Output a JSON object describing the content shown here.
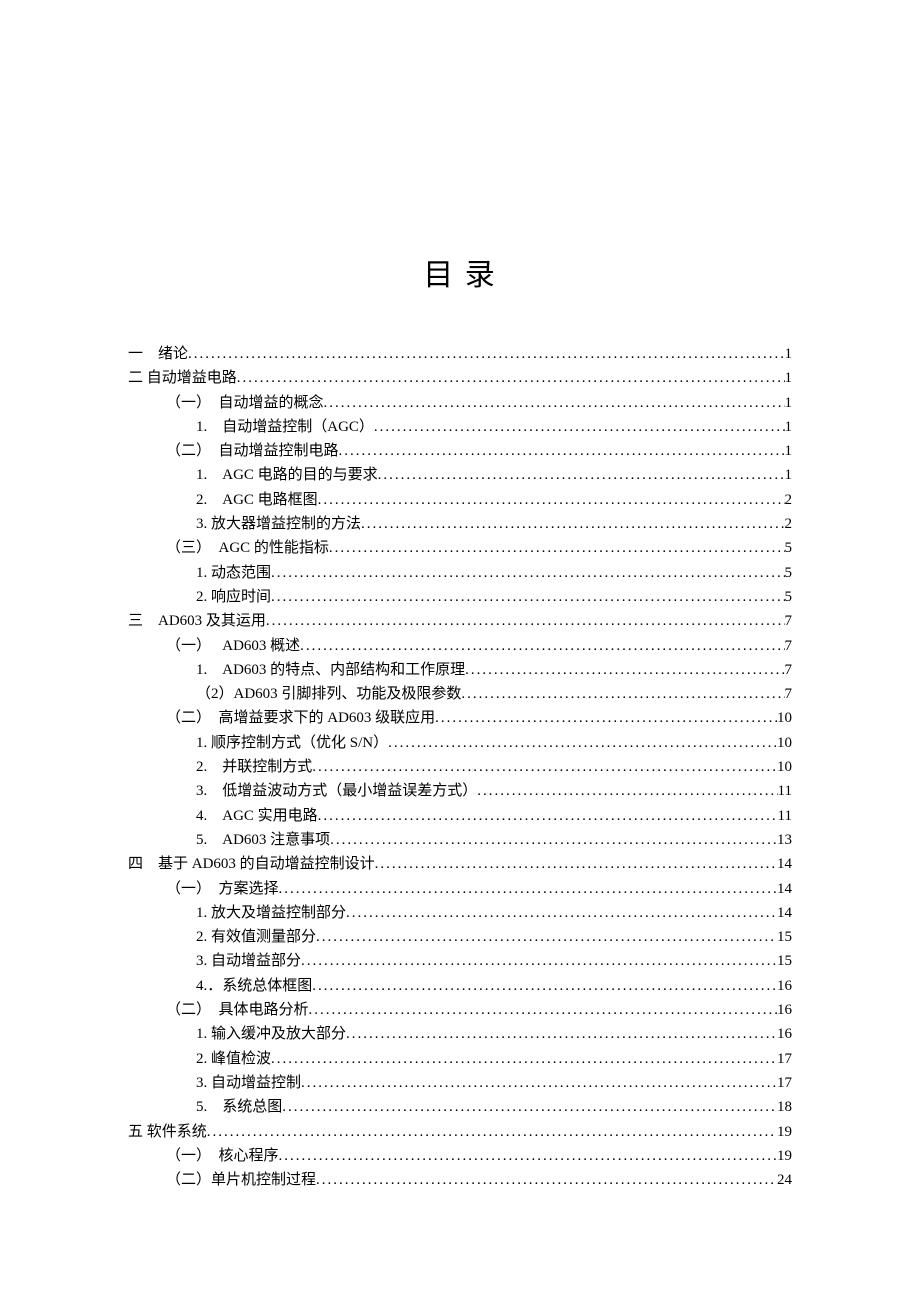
{
  "title": "目 录",
  "toc": [
    {
      "lvl": 1,
      "label": "一　绪论",
      "page": "1"
    },
    {
      "lvl": 1,
      "label": "二  自动增益电路",
      "page": "1"
    },
    {
      "lvl": 2,
      "label": "（一）　自动增益的概念",
      "page": "1"
    },
    {
      "lvl": 3,
      "label": "1.　自动增益控制（AGC）",
      "page": "1"
    },
    {
      "lvl": 2,
      "label": "（二）　自动增益控制电路",
      "page": "1"
    },
    {
      "lvl": 3,
      "label": "1.　AGC 电路的目的与要求",
      "page": "1"
    },
    {
      "lvl": 3,
      "label": "2.　AGC 电路框图",
      "page": "2"
    },
    {
      "lvl": 3,
      "label": "3. 放大器增益控制的方法",
      "page": "2"
    },
    {
      "lvl": 2,
      "label": "（三）　AGC 的性能指标",
      "page": "5"
    },
    {
      "lvl": 3,
      "label": "1. 动态范围",
      "page": "5"
    },
    {
      "lvl": 3,
      "label": "2. 响应时间",
      "page": "5"
    },
    {
      "lvl": 1,
      "label": "三　AD603 及其运用",
      "page": "7"
    },
    {
      "lvl": 2,
      "label": "（一）　 AD603 概述",
      "page": "7"
    },
    {
      "lvl": 3,
      "label": "1.　AD603 的特点、内部结构和工作原理",
      "page": "7"
    },
    {
      "lvl": 3,
      "label": "（2）AD603 引脚排列、功能及极限参数",
      "page": "7"
    },
    {
      "lvl": 2,
      "label": "（二）　高增益要求下的 AD603 级联应用",
      "page": "10"
    },
    {
      "lvl": 3,
      "label": "1. 顺序控制方式（优化 S/N）",
      "page": "10"
    },
    {
      "lvl": 3,
      "label": "2.　并联控制方式",
      "page": "10"
    },
    {
      "lvl": 3,
      "label": "3.　低增益波动方式（最小增益误差方式）",
      "page": "11"
    },
    {
      "lvl": 3,
      "label": "4.　AGC 实用电路",
      "page": "11"
    },
    {
      "lvl": 3,
      "label": "5.　AD603 注意事项",
      "page": "13"
    },
    {
      "lvl": 1,
      "label": "四　基于 AD603 的自动增益控制设计",
      "page": "14"
    },
    {
      "lvl": 2,
      "label": "（一）　方案选择",
      "page": "14"
    },
    {
      "lvl": 3,
      "label": "1. 放大及增益控制部分",
      "page": "14"
    },
    {
      "lvl": 3,
      "label": "2. 有效值测量部分",
      "page": "15"
    },
    {
      "lvl": 3,
      "label": "3. 自动增益部分",
      "page": "15"
    },
    {
      "lvl": 3,
      "label": "4.．系统总体框图",
      "page": "16"
    },
    {
      "lvl": 2,
      "label": "（二）　具体电路分析",
      "page": "16"
    },
    {
      "lvl": 3,
      "label": "1. 输入缓冲及放大部分",
      "page": "16"
    },
    {
      "lvl": 3,
      "label": "2. 峰值检波",
      "page": "17"
    },
    {
      "lvl": 3,
      "label": "3. 自动增益控制",
      "page": "17"
    },
    {
      "lvl": 3,
      "label": "5.　系统总图",
      "page": "18"
    },
    {
      "lvl": 1,
      "label": "五  软件系统",
      "page": "19"
    },
    {
      "lvl": 2,
      "label": "（一）　核心程序",
      "page": "19"
    },
    {
      "lvl": 2,
      "label": "（二）单片机控制过程",
      "page": "24"
    }
  ]
}
